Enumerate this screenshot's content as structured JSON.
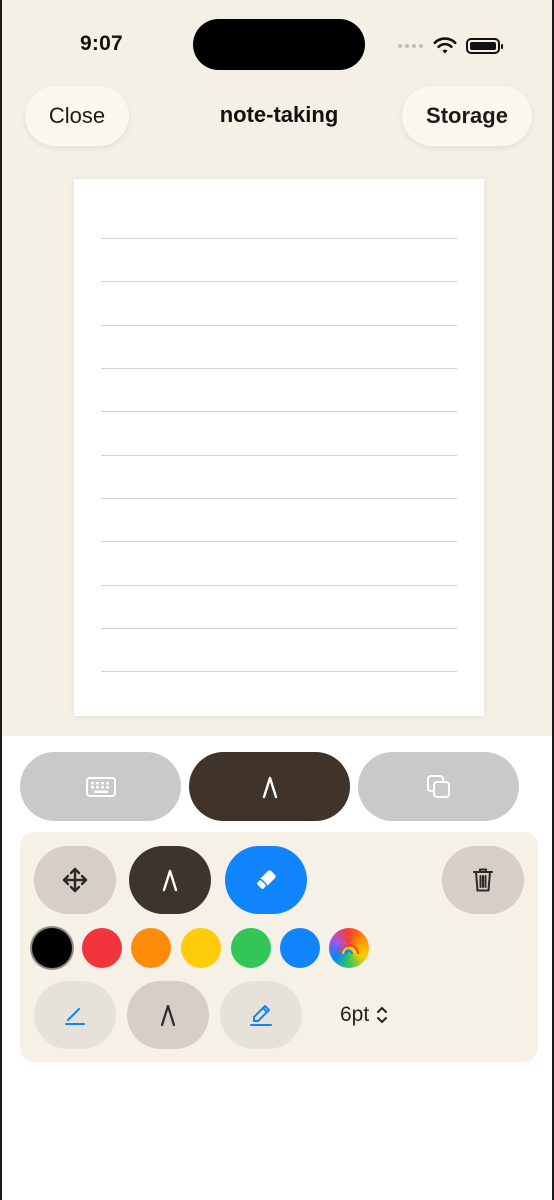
{
  "status_bar": {
    "time": "9:07"
  },
  "nav": {
    "close_label": "Close",
    "title": "note-taking",
    "storage_label": "Storage"
  },
  "mode_switcher": {
    "modes": [
      {
        "name": "keyboard",
        "icon": "keyboard-icon",
        "selected": false
      },
      {
        "name": "pen",
        "icon": "pen-nib-icon",
        "selected": true
      },
      {
        "name": "pages",
        "icon": "duplicate-icon",
        "selected": false
      }
    ]
  },
  "tools": {
    "move_icon": "move-arrows-icon",
    "pen_icon": "pen-nib-icon",
    "eraser_icon": "eraser-icon",
    "trash_icon": "trash-icon",
    "colors": [
      {
        "name": "black",
        "hex": "#000000",
        "selected": true
      },
      {
        "name": "red",
        "hex": "#f2353c"
      },
      {
        "name": "orange",
        "hex": "#fd8c0b"
      },
      {
        "name": "yellow",
        "hex": "#fecc09"
      },
      {
        "name": "green",
        "hex": "#33c657"
      },
      {
        "name": "blue",
        "hex": "#0f84fb"
      },
      {
        "name": "rainbow",
        "icon": "rainbow-icon"
      }
    ],
    "pen_types": [
      {
        "name": "fine-pen",
        "icon": "pen-line-icon"
      },
      {
        "name": "nib",
        "icon": "pen-nib-icon",
        "selected": true
      },
      {
        "name": "pencil",
        "icon": "pencil-icon"
      }
    ],
    "size_label": "6pt"
  },
  "theme": {
    "background": "#f4f0e5",
    "accent_blue": "#0f84fb",
    "dark_brown": "#40332a"
  }
}
